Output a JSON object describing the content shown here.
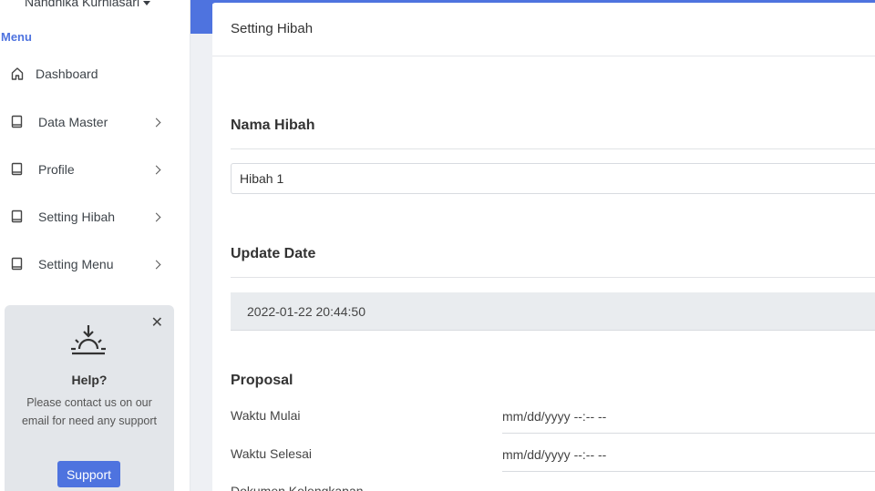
{
  "sidebar": {
    "user_name": "Nandhika Kurniasari",
    "menu_heading": "Menu",
    "items": [
      {
        "label": "Dashboard",
        "icon": "home-icon"
      },
      {
        "label": "Data Master",
        "icon": "book-icon"
      },
      {
        "label": "Profile",
        "icon": "book-icon"
      },
      {
        "label": "Setting Hibah",
        "icon": "book-icon"
      },
      {
        "label": "Setting Menu",
        "icon": "book-icon"
      }
    ],
    "help": {
      "title": "Help?",
      "text": "Please contact us on our email for need any support",
      "button": "Support",
      "close": "✕"
    }
  },
  "card": {
    "title": "Setting Hibah",
    "nama_hibah": {
      "label": "Nama Hibah",
      "value": "Hibah 1"
    },
    "update_date": {
      "label": "Update Date",
      "value": "2022-01-22 20:44:50"
    },
    "proposal": {
      "label": "Proposal",
      "waktu_mulai": {
        "label": "Waktu Mulai",
        "placeholder": "mm/dd/yyyy  --:-- --"
      },
      "waktu_selesai": {
        "label": "Waktu Selesai",
        "placeholder": "mm/dd/yyyy  --:-- --"
      },
      "dokumen": {
        "label": "Dokumen Kelengkapan"
      }
    }
  },
  "colors": {
    "accent": "#4e73df",
    "sidebar_bg": "#ffffff",
    "help_bg": "#e3e6ea"
  }
}
